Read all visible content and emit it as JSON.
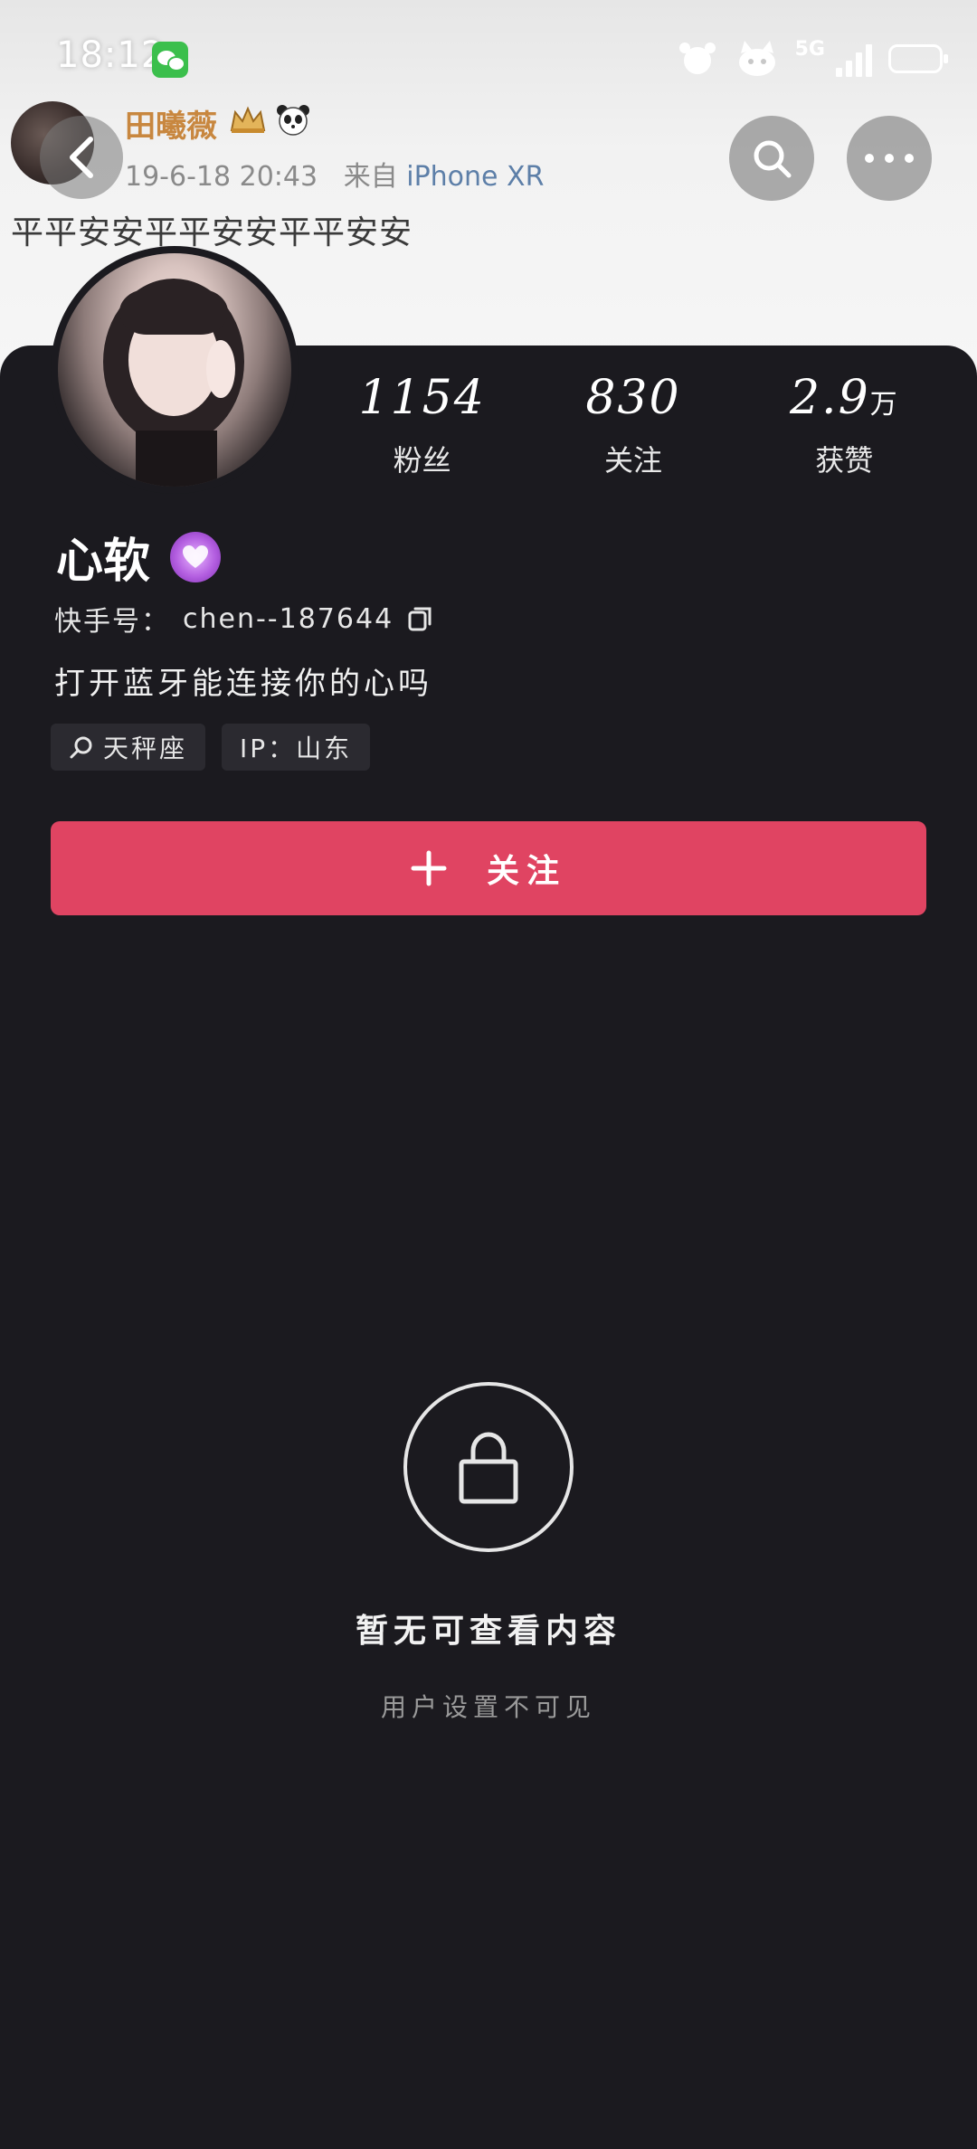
{
  "status_bar": {
    "time": "18:12",
    "network": "5G"
  },
  "post": {
    "author": "田曦薇",
    "date": "19-6-18 20:43",
    "from_prefix": "来自",
    "device": "iPhone XR",
    "text": "平平安安平平安安平平安安"
  },
  "profile": {
    "nickname": "心软",
    "id_label": "快手号：",
    "id_value": "chen--187644",
    "bio": "打开蓝牙能连接你的心吗",
    "tags": [
      {
        "icon": "search-icon",
        "label": "天秤座"
      },
      {
        "label": "IP：山东"
      }
    ],
    "stats": [
      {
        "value": "1154",
        "unit": "",
        "label": "粉丝"
      },
      {
        "value": "830",
        "unit": "",
        "label": "关注"
      },
      {
        "value": "2.9",
        "unit": "万",
        "label": "获赞"
      }
    ]
  },
  "follow_button": {
    "label": "关注"
  },
  "empty_state": {
    "title": "暂无可查看内容",
    "subtitle": "用户设置不可见"
  },
  "colors": {
    "accent": "#e04462",
    "background": "#1b1a1f",
    "author_name": "#c8873f",
    "device_link": "#5d7fa8"
  }
}
